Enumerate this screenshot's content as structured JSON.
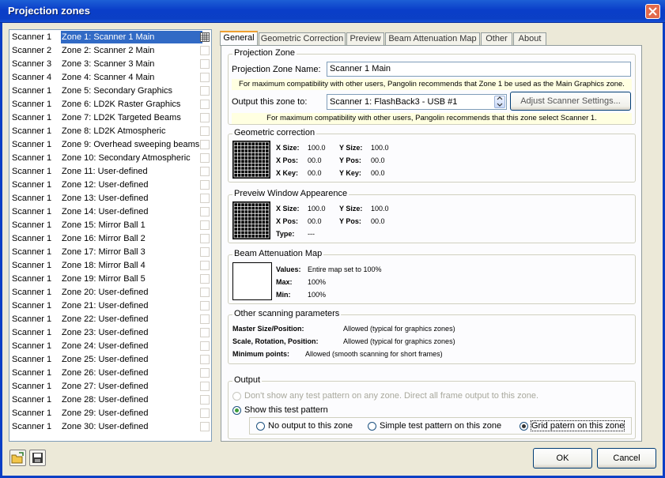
{
  "window": {
    "title": "Projection zones"
  },
  "zones": [
    {
      "scanner": "Scanner 1",
      "name": "Zone 1: Scanner 1 Main",
      "selected": true
    },
    {
      "scanner": "Scanner 2",
      "name": "Zone 2: Scanner 2 Main"
    },
    {
      "scanner": "Scanner 3",
      "name": "Zone 3: Scanner 3 Main"
    },
    {
      "scanner": "Scanner 4",
      "name": "Zone 4: Scanner 4 Main"
    },
    {
      "scanner": "Scanner 1",
      "name": "Zone 5: Secondary Graphics"
    },
    {
      "scanner": "Scanner 1",
      "name": "Zone 6: LD2K Raster Graphics"
    },
    {
      "scanner": "Scanner 1",
      "name": "Zone 7: LD2K Targeted Beams"
    },
    {
      "scanner": "Scanner 1",
      "name": "Zone 8: LD2K Atmospheric"
    },
    {
      "scanner": "Scanner 1",
      "name": "Zone 9: Overhead sweeping beams"
    },
    {
      "scanner": "Scanner 1",
      "name": "Zone 10: Secondary Atmospheric"
    },
    {
      "scanner": "Scanner 1",
      "name": "Zone 11: User-defined"
    },
    {
      "scanner": "Scanner 1",
      "name": "Zone 12: User-defined"
    },
    {
      "scanner": "Scanner 1",
      "name": "Zone 13: User-defined"
    },
    {
      "scanner": "Scanner 1",
      "name": "Zone 14: User-defined"
    },
    {
      "scanner": "Scanner 1",
      "name": "Zone 15: Mirror Ball 1"
    },
    {
      "scanner": "Scanner 1",
      "name": "Zone 16: Mirror Ball 2"
    },
    {
      "scanner": "Scanner 1",
      "name": "Zone 17: Mirror Ball 3"
    },
    {
      "scanner": "Scanner 1",
      "name": "Zone 18: Mirror Ball 4"
    },
    {
      "scanner": "Scanner 1",
      "name": "Zone 19: Mirror Ball 5"
    },
    {
      "scanner": "Scanner 1",
      "name": "Zone 20: User-defined"
    },
    {
      "scanner": "Scanner 1",
      "name": "Zone 21: User-defined"
    },
    {
      "scanner": "Scanner 1",
      "name": "Zone 22: User-defined"
    },
    {
      "scanner": "Scanner 1",
      "name": "Zone 23: User-defined"
    },
    {
      "scanner": "Scanner 1",
      "name": "Zone 24: User-defined"
    },
    {
      "scanner": "Scanner 1",
      "name": "Zone 25: User-defined"
    },
    {
      "scanner": "Scanner 1",
      "name": "Zone 26: User-defined"
    },
    {
      "scanner": "Scanner 1",
      "name": "Zone 27: User-defined"
    },
    {
      "scanner": "Scanner 1",
      "name": "Zone 28: User-defined"
    },
    {
      "scanner": "Scanner 1",
      "name": "Zone 29: User-defined"
    },
    {
      "scanner": "Scanner 1",
      "name": "Zone 30: User-defined"
    }
  ],
  "tabs": [
    "General",
    "Geometric Correction",
    "Preview",
    "Beam Attenuation Map",
    "Other",
    "About"
  ],
  "active_tab": "General",
  "projection_zone": {
    "group_title": "Projection Zone",
    "name_label": "Projection Zone Name:",
    "name_value": "Scanner 1 Main",
    "name_note": "For maximum compatibility with other users, Pangolin recommends that Zone 1 be used as the Main Graphics zone.",
    "output_label": "Output this zone to:",
    "output_value": "Scanner 1: FlashBack3 - USB #1",
    "adjust_button": "Adjust Scanner Settings...",
    "output_note": "For maximum compatibility with other users, Pangolin recommends that this zone select Scanner 1."
  },
  "geometric": {
    "group_title": "Geometric correction",
    "x_size_label": "X Size:",
    "x_size": "100.0",
    "y_size_label": "Y Size:",
    "y_size": "100.0",
    "x_pos_label": "X Pos:",
    "x_pos": "00.0",
    "y_pos_label": "Y Pos:",
    "y_pos": "00.0",
    "x_key_label": "X Key:",
    "x_key": "00.0",
    "y_key_label": "Y Key:",
    "y_key": "00.0"
  },
  "preview": {
    "group_title": "Preveiw Window Appearence",
    "x_size_label": "X Size:",
    "x_size": "100.0",
    "y_size_label": "Y Size:",
    "y_size": "100.0",
    "x_pos_label": "X Pos:",
    "x_pos": "00.0",
    "y_pos_label": "Y Pos:",
    "y_pos": "00.0",
    "type_label": "Type:",
    "type": "---"
  },
  "attenuation": {
    "group_title": "Beam Attenuation Map",
    "values_label": "Values:",
    "values": "Entire map set to 100%",
    "max_label": "Max:",
    "max": "100%",
    "min_label": "Min:",
    "min": "100%"
  },
  "other": {
    "group_title": "Other scanning parameters",
    "master_label": "Master Size/Position:",
    "master": "Allowed (typical for graphics zones)",
    "scale_label": "Scale, Rotation, Position:",
    "scale": "Allowed (typical for graphics zones)",
    "minpts_label": "Minimum points:",
    "minpts": "Allowed (smooth scanning for short frames)"
  },
  "output": {
    "group_title": "Output",
    "option_none": "Don't show any test pattern on any zone. Direct all frame output to this zone.",
    "option_show": "Show this test pattern",
    "sub_none": "No output to this zone",
    "sub_simple": "Simple test pattern on this zone",
    "sub_grid": "Grid patern on this zone"
  },
  "buttons": {
    "ok": "OK",
    "cancel": "Cancel"
  },
  "colors": {
    "title_bar": "#0a3ec9",
    "selection": "#316ac5",
    "note_bg": "#ffffe1",
    "tab_accent": "#f0a030"
  }
}
